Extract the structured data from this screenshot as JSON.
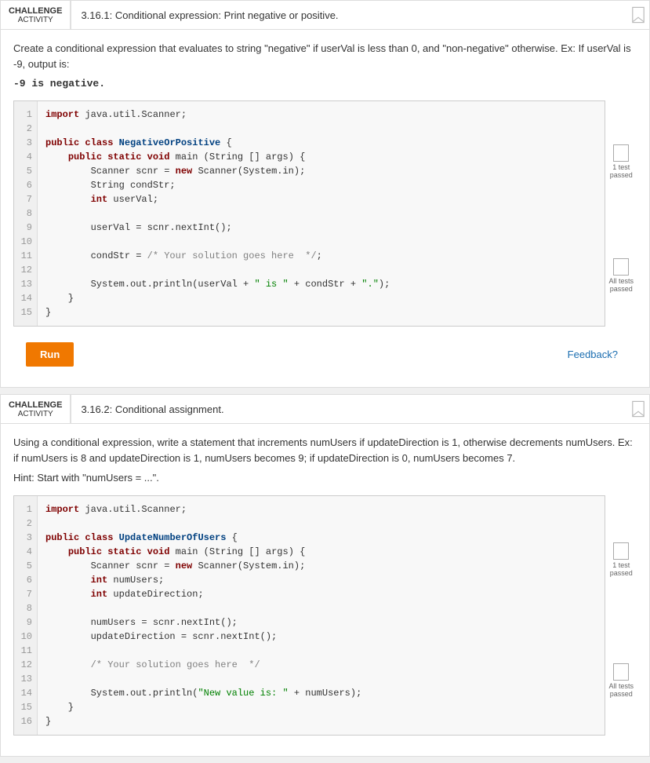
{
  "block1": {
    "label_top": "CHALLENGE",
    "label_bottom": "ACTIVITY",
    "title": "3.16.1: Conditional expression: Print negative or positive.",
    "description": "Create a conditional expression that evaluates to string \"negative\" if userVal is less than 0, and \"non-negative\" otherwise. Ex: If userVal is -9, output is:",
    "code_example": "-9 is negative.",
    "run_label": "Run",
    "feedback_label": "Feedback?",
    "test1_label": "1 test\npassed",
    "test2_label": "All tests\npassed",
    "code_lines": [
      "1",
      "2",
      "3",
      "4",
      "5",
      "6",
      "7",
      "8",
      "9",
      "10",
      "11",
      "12",
      "13",
      "14",
      "15"
    ],
    "code_content": "import java.util.Scanner;\n\npublic class NegativeOrPositive {\n    public static void main (String [] args) {\n        Scanner scnr = new Scanner(System.in);\n        String condStr;\n        int userVal;\n\n        userVal = scnr.nextInt();\n\n        condStr = /* Your solution goes here  */;\n\n        System.out.println(userVal + \" is \" + condStr + \".\");\n    }\n}"
  },
  "block2": {
    "label_top": "CHALLENGE",
    "label_bottom": "ACTIVITY",
    "title": "3.16.2: Conditional assignment.",
    "description": "Using a conditional expression, write a statement that increments numUsers if updateDirection is 1, otherwise decrements numUsers. Ex: if numUsers is 8 and updateDirection is 1, numUsers becomes 9; if updateDirection is 0, numUsers becomes 7.",
    "hint": "Hint: Start with \"numUsers = ...\".",
    "test1_label": "1 test\npassed",
    "test2_label": "All tests\npassed",
    "code_lines": [
      "1",
      "2",
      "3",
      "4",
      "5",
      "6",
      "7",
      "8",
      "9",
      "10",
      "11",
      "12",
      "13",
      "14",
      "15",
      "16"
    ],
    "code_content": "import java.util.Scanner;\n\npublic class UpdateNumberOfUsers {\n    public static void main (String [] args) {\n        Scanner scnr = new Scanner(System.in);\n        int numUsers;\n        int updateDirection;\n\n        numUsers = scnr.nextInt();\n        updateDirection = scnr.nextInt();\n\n        /* Your solution goes here  */\n\n        System.out.println(\"New value is: \" + numUsers);\n    }\n}"
  }
}
